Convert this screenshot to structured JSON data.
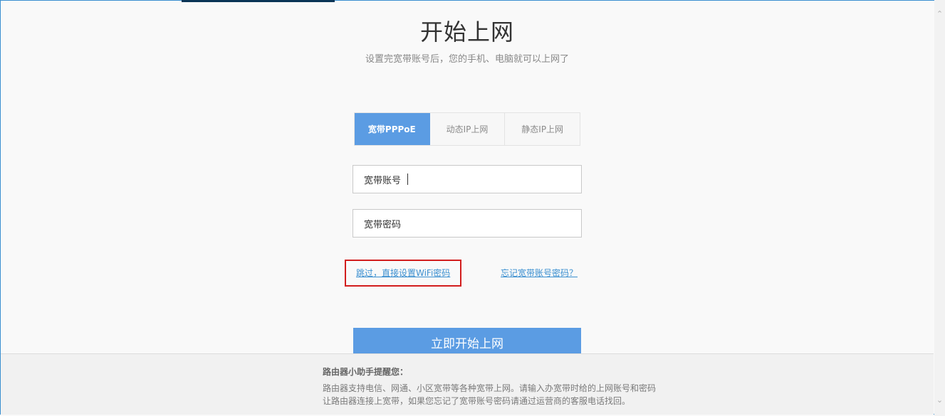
{
  "page": {
    "title": "开始上网",
    "subtitle": "设置完宽带账号后，您的手机、电脑就可以上网了"
  },
  "tabs": [
    {
      "label": "宽带PPPoE",
      "active": true
    },
    {
      "label": "动态IP上网",
      "active": false
    },
    {
      "label": "静态IP上网",
      "active": false
    }
  ],
  "form": {
    "account_label": "宽带账号",
    "account_value": "",
    "password_label": "宽带密码",
    "password_value": ""
  },
  "links": {
    "skip": "跳过，直接设置WiFi密码",
    "forgot": "忘记宽带账号密码？"
  },
  "submit_label": "立即开始上网",
  "tip": {
    "title": "路由器小助手提醒您：",
    "line1": "路由器支持电信、网通、小区宽带等各种宽带上网。请输入办宽带时给的上网账号和密码",
    "line2": "让路由器连接上宽带，如果您忘记了宽带账号密码请通过运营商的客服电话找回。"
  },
  "colors": {
    "accent": "#5b9ce3",
    "link": "#3a8fd0",
    "highlight_box": "#d21d1d"
  },
  "icons": {
    "scroll_up": "chevron-up-icon",
    "scroll_down": "chevron-down-icon"
  }
}
